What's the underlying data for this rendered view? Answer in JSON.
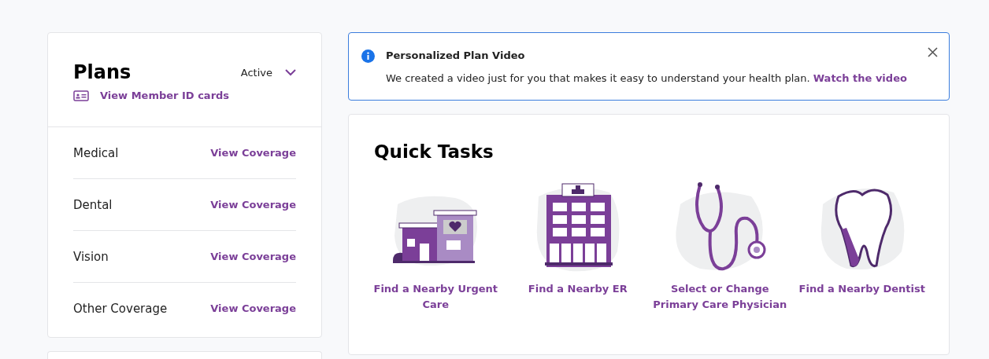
{
  "plans": {
    "title": "Plans",
    "filter": "Active",
    "id_cards_link": "View Member ID cards",
    "coverage": [
      {
        "name": "Medical",
        "link": "View Coverage"
      },
      {
        "name": "Dental",
        "link": "View Coverage"
      },
      {
        "name": "Vision",
        "link": "View Coverage"
      },
      {
        "name": "Other Coverage",
        "link": "View Coverage"
      }
    ]
  },
  "alert": {
    "title": "Personalized Plan Video",
    "message": "We created a video just for you that makes it easy to understand your health plan.",
    "link": "Watch the video"
  },
  "quick_tasks": {
    "title": "Quick Tasks",
    "tasks": [
      {
        "kind": "urgent-care",
        "label": "Find a Nearby Urgent Care"
      },
      {
        "kind": "hospital",
        "label": "Find a Nearby ER"
      },
      {
        "kind": "stethoscope",
        "label": "Select or Change Primary Care Physician"
      },
      {
        "kind": "tooth",
        "label": "Find a Nearby Dentist"
      }
    ]
  }
}
